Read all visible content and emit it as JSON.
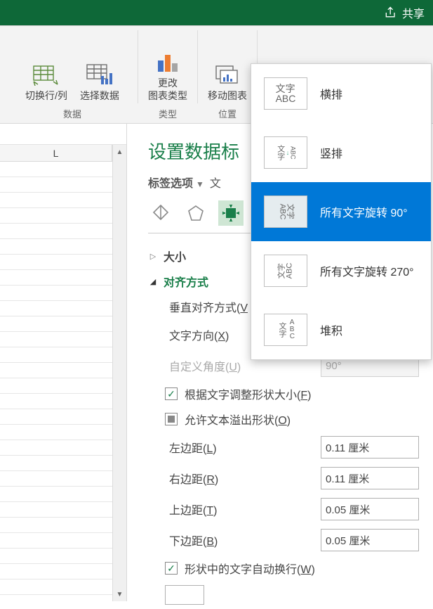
{
  "titlebar": {
    "share_label": "共享"
  },
  "ribbon": {
    "btn_switch": "切换行/列",
    "btn_select_data": "选择数据",
    "group_data": "数据",
    "btn_change_type": "更改\n图表类型",
    "group_type": "类型",
    "btn_move_chart": "移动图表",
    "group_position": "位置"
  },
  "grid": {
    "col_L": "L"
  },
  "pane": {
    "title": "设置数据标",
    "tab_label_options": "标签选项",
    "tab_text": "文",
    "section_size": "大小",
    "section_align": "对齐方式",
    "f_valign": {
      "pre": "垂直对齐方式(",
      "k": "V",
      "post": ""
    },
    "f_textdir": {
      "pre": "文字方向(",
      "k": "X",
      "post": ")"
    },
    "f_custom_angle": {
      "pre": "自定义角度(",
      "k": "U",
      "post": ")"
    },
    "f_autofit": {
      "pre": "根据文字调整形状大小(",
      "k": "F",
      "post": ")"
    },
    "f_overflow": {
      "pre": "允许文本溢出形状(",
      "k": "O",
      "post": ")"
    },
    "f_left": {
      "pre": "左边距(",
      "k": "L",
      "post": ")"
    },
    "f_right": {
      "pre": "右边距(",
      "k": "R",
      "post": ")"
    },
    "f_top": {
      "pre": "上边距(",
      "k": "T",
      "post": ")"
    },
    "f_bottom": {
      "pre": "下边距(",
      "k": "B",
      "post": ")"
    },
    "f_wrap": {
      "pre": "形状中的文字自动换行(",
      "k": "W",
      "post": ")"
    },
    "textdir_value": "所有文字旋...",
    "angle_value": "90°",
    "margin_left": "0.11 厘米",
    "margin_right": "0.11 厘米",
    "margin_top": "0.05 厘米",
    "margin_bottom": "0.05 厘米"
  },
  "popup": {
    "opt_horizontal": "横排",
    "opt_vertical": "竖排",
    "opt_rot90": "所有文字旋转 90°",
    "opt_rot270": "所有文字旋转 270°",
    "opt_stacked": "堆积"
  }
}
